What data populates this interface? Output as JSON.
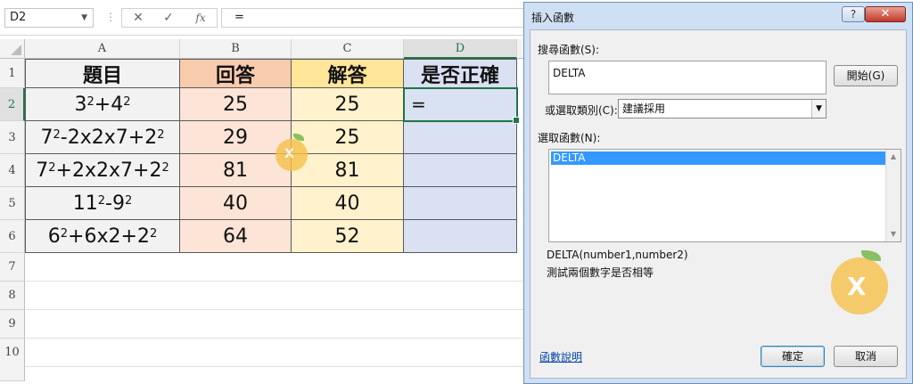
{
  "formula_bar": {
    "name_box": "D2",
    "cancel_glyph": "✕",
    "enter_glyph": "✓",
    "fx_glyph": "fx",
    "formula": "="
  },
  "columns": [
    "A",
    "B",
    "C",
    "D"
  ],
  "rows": [
    "1",
    "2",
    "3",
    "4",
    "5",
    "6",
    "7",
    "8",
    "9",
    "10"
  ],
  "table": {
    "headers": [
      "題目",
      "回答",
      "解答",
      "是否正確"
    ],
    "header_colors": [
      "#f2f2f2",
      "#f8cbad",
      "#ffe699",
      "#d9e1f2"
    ],
    "body_colors": [
      "#f2f2f2",
      "#fce4d6",
      "#fff2cc",
      "#d9e1f2"
    ],
    "rows": [
      {
        "q": [
          [
            "3",
            "2"
          ],
          [
            "+4",
            "2"
          ]
        ],
        "answer": "25",
        "solution": "25",
        "correct": "="
      },
      {
        "q": [
          [
            "7",
            "2"
          ],
          [
            "-2x2x7+2",
            "2"
          ]
        ],
        "answer": "29",
        "solution": "25",
        "correct": ""
      },
      {
        "q": [
          [
            "7",
            "2"
          ],
          [
            "+2x2x7+2",
            "2"
          ]
        ],
        "answer": "81",
        "solution": "81",
        "correct": ""
      },
      {
        "q": [
          [
            "11",
            "2"
          ],
          [
            "-9",
            "2"
          ]
        ],
        "answer": "40",
        "solution": "40",
        "correct": ""
      },
      {
        "q": [
          [
            "6",
            "2"
          ],
          [
            "+6x2+2",
            "2"
          ]
        ],
        "answer": "64",
        "solution": "52",
        "correct": ""
      }
    ]
  },
  "dialog": {
    "title": "插入函數",
    "help_glyph": "?",
    "close_glyph": "✕",
    "search_label": "搜尋函數(S):",
    "search_value": "DELTA",
    "go_button": "開始(G)",
    "category_label": "或選取類別(C):",
    "category_value": "建議採用",
    "function_label": "選取函數(N):",
    "functions": [
      "DELTA"
    ],
    "signature": "DELTA(number1,number2)",
    "description": "測試兩個數字是否相等",
    "help_link": "函數說明",
    "ok_button": "確定",
    "cancel_button": "取消"
  },
  "colors": {
    "excel_green": "#217346",
    "dialog_frame": "#cfe0f4",
    "selection_blue": "#3399ff"
  }
}
